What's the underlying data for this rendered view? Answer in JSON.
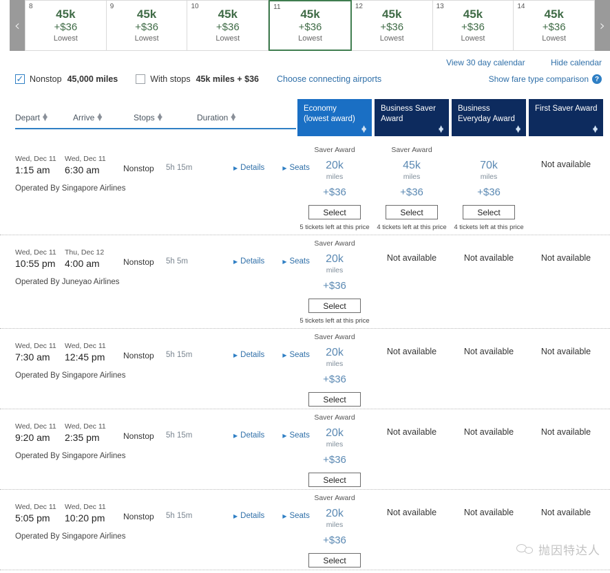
{
  "calendar": {
    "prev_label": "‹",
    "next_label": "›",
    "days": [
      {
        "day": "8",
        "miles": "45k",
        "price": "+$36",
        "note": "Lowest",
        "selected": false
      },
      {
        "day": "9",
        "miles": "45k",
        "price": "+$36",
        "note": "Lowest",
        "selected": false
      },
      {
        "day": "10",
        "miles": "45k",
        "price": "+$36",
        "note": "Lowest",
        "selected": false
      },
      {
        "day": "11",
        "miles": "45k",
        "price": "+$36",
        "note": "Lowest",
        "selected": true
      },
      {
        "day": "12",
        "miles": "45k",
        "price": "+$36",
        "note": "Lowest",
        "selected": false
      },
      {
        "day": "13",
        "miles": "45k",
        "price": "+$36",
        "note": "Lowest",
        "selected": false
      },
      {
        "day": "14",
        "miles": "45k",
        "price": "+$36",
        "note": "Lowest",
        "selected": false
      }
    ]
  },
  "links": {
    "view_30_day": "View 30 day calendar",
    "hide_calendar": "Hide calendar",
    "fare_comparison": "Show fare type comparison",
    "help_badge": "?"
  },
  "filters": {
    "nonstop_label": "Nonstop",
    "nonstop_value": "45,000 miles",
    "nonstop_checked": true,
    "withstops_label": "With stops",
    "withstops_value": "45k miles + $36",
    "withstops_checked": false,
    "connecting_link": "Choose connecting airports"
  },
  "sort_headers": [
    {
      "label": "Depart"
    },
    {
      "label": "Arrive"
    },
    {
      "label": "Stops"
    },
    {
      "label": "Duration"
    }
  ],
  "fare_columns": [
    {
      "line1": "Economy",
      "line2": "(lowest award)",
      "active": true
    },
    {
      "line1": "Business Saver",
      "line2": "Award",
      "active": false
    },
    {
      "line1": "Business",
      "line2": "Everyday Award",
      "active": false
    },
    {
      "line1": "First Saver Award",
      "line2": "",
      "active": false
    }
  ],
  "row_labels": {
    "details": "Details",
    "seats": "Seats",
    "select": "Select",
    "saver_award": "Saver Award",
    "miles_unit": "miles",
    "not_available": "Not available"
  },
  "flights": [
    {
      "depart_date": "Wed, Dec 11",
      "depart_time": "1:15 am",
      "arrive_date": "Wed, Dec 11",
      "arrive_time": "6:30 am",
      "stops": "Nonstop",
      "duration": "5h 15m",
      "operated_by": "Operated By Singapore Airlines",
      "fares": [
        {
          "available": true,
          "label": "Saver Award",
          "miles": "20k",
          "price": "+$36",
          "tickets": "5 tickets left at this price"
        },
        {
          "available": true,
          "label": "Saver Award",
          "miles": "45k",
          "price": "+$36",
          "tickets": "4 tickets left at this price"
        },
        {
          "available": true,
          "label": "",
          "miles": "70k",
          "price": "+$36",
          "tickets": "4 tickets left at this price"
        },
        {
          "available": false
        }
      ]
    },
    {
      "depart_date": "Wed, Dec 11",
      "depart_time": "10:55 pm",
      "arrive_date": "Thu, Dec 12",
      "arrive_time": "4:00 am",
      "stops": "Nonstop",
      "duration": "5h 5m",
      "operated_by": "Operated By Juneyao Airlines",
      "fares": [
        {
          "available": true,
          "label": "Saver Award",
          "miles": "20k",
          "price": "+$36",
          "tickets": "5 tickets left at this price"
        },
        {
          "available": false
        },
        {
          "available": false
        },
        {
          "available": false
        }
      ]
    },
    {
      "depart_date": "Wed, Dec 11",
      "depart_time": "7:30 am",
      "arrive_date": "Wed, Dec 11",
      "arrive_time": "12:45 pm",
      "stops": "Nonstop",
      "duration": "5h 15m",
      "operated_by": "Operated By Singapore Airlines",
      "fares": [
        {
          "available": true,
          "label": "Saver Award",
          "miles": "20k",
          "price": "+$36",
          "tickets": ""
        },
        {
          "available": false
        },
        {
          "available": false
        },
        {
          "available": false
        }
      ]
    },
    {
      "depart_date": "Wed, Dec 11",
      "depart_time": "9:20 am",
      "arrive_date": "Wed, Dec 11",
      "arrive_time": "2:35 pm",
      "stops": "Nonstop",
      "duration": "5h 15m",
      "operated_by": "Operated By Singapore Airlines",
      "fares": [
        {
          "available": true,
          "label": "Saver Award",
          "miles": "20k",
          "price": "+$36",
          "tickets": ""
        },
        {
          "available": false
        },
        {
          "available": false
        },
        {
          "available": false
        }
      ]
    },
    {
      "depart_date": "Wed, Dec 11",
      "depart_time": "5:05 pm",
      "arrive_date": "Wed, Dec 11",
      "arrive_time": "10:20 pm",
      "stops": "Nonstop",
      "duration": "5h 15m",
      "operated_by": "Operated By Singapore Airlines",
      "fares": [
        {
          "available": true,
          "label": "Saver Award",
          "miles": "20k",
          "price": "+$36",
          "tickets": ""
        },
        {
          "available": false
        },
        {
          "available": false
        },
        {
          "available": false
        }
      ]
    }
  ],
  "watermark": {
    "text": "抛因特达人"
  },
  "colors": {
    "header_navy": "#0d2b5e",
    "header_active_blue": "#1a6fc4",
    "link_blue": "#2f6fa8",
    "calendar_green": "#3f6b46",
    "selected_border_green": "#3f7d4f",
    "fare_blue": "#5b89b3"
  }
}
